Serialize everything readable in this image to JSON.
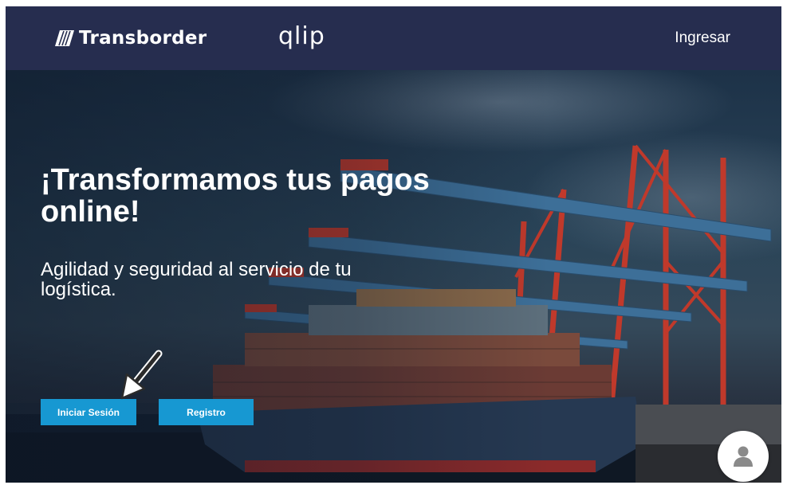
{
  "nav": {
    "brand": "Transborder",
    "product": "qlip",
    "login_link": "Ingresar"
  },
  "hero": {
    "headline_line1": "¡Transformamos tus pagos",
    "headline_line2": "online!",
    "subtitle_line1": "Agilidad y seguridad al servicio de tu",
    "subtitle_line2": "logística.",
    "login_button": "Iniciar Sesión",
    "register_button": "Registro"
  },
  "icons": {
    "brand_mark": "diagonal-stripes-logo-icon",
    "pointer": "annotation-arrow-icon",
    "chat": "user-avatar-icon"
  },
  "colors": {
    "navbar": "#262d4f",
    "accent_button": "#1798d2",
    "text": "#ffffff",
    "crane": "#c0392b"
  }
}
